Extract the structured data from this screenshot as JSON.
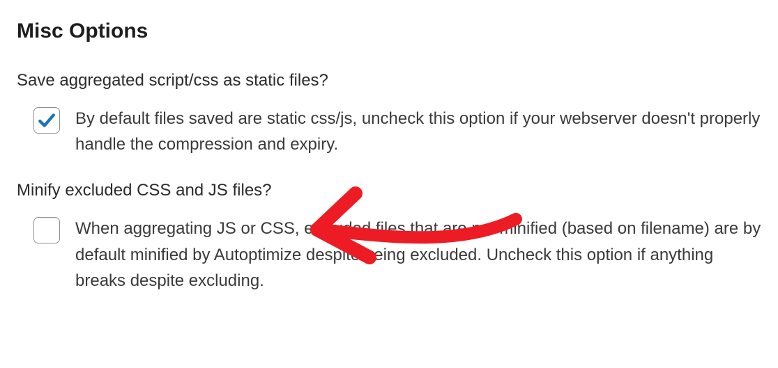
{
  "section": {
    "title": "Misc Options"
  },
  "options": {
    "static_files": {
      "label": "Save aggregated script/css as static files?",
      "checked": true,
      "description": "By default files saved are static css/js, uncheck this option if your webserver doesn't properly handle the compression and expiry."
    },
    "minify_excluded": {
      "label": "Minify excluded CSS and JS files?",
      "checked": false,
      "description": "When aggregating JS or CSS, excluded files that are not minified (based on filename) are by default minified by Autoptimize despite being excluded. Uncheck this option if anything breaks despite excluding."
    }
  },
  "annotation": {
    "type": "arrow",
    "color": "#ed1c24"
  }
}
